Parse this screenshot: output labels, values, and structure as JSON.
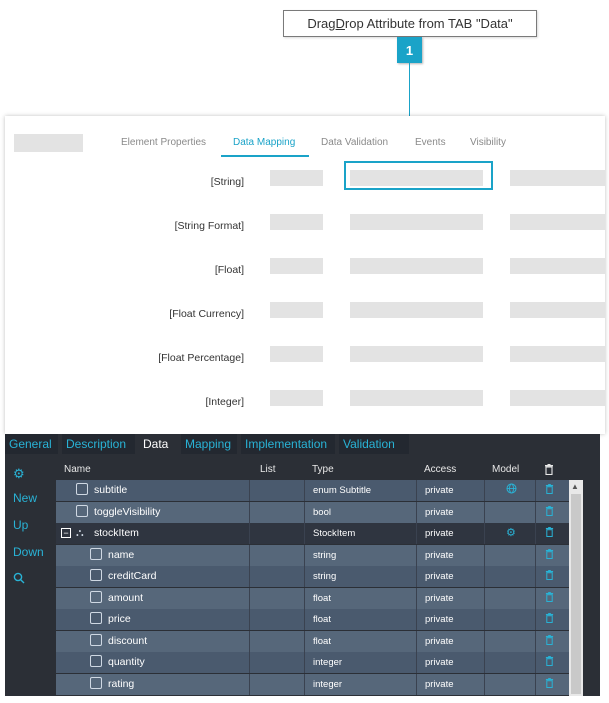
{
  "callout": {
    "text_pre": "Drag",
    "text_u": "D",
    "text_post": "rop Attribute from TAB \"Data\"",
    "badge": "1"
  },
  "properties_panel": {
    "tabs": [
      {
        "label": "Element Properties",
        "active": false
      },
      {
        "label": "Data Mapping",
        "active": true
      },
      {
        "label": "Data Validation",
        "active": false
      },
      {
        "label": "Events",
        "active": false
      },
      {
        "label": "Visibility",
        "active": false
      }
    ],
    "fields": [
      {
        "label": "[String]"
      },
      {
        "label": "[String Format]"
      },
      {
        "label": "[Float]"
      },
      {
        "label": "[Float Currency]"
      },
      {
        "label": "[Float Percentage]"
      },
      {
        "label": "[Integer]"
      }
    ]
  },
  "editor_panel": {
    "tabs": [
      {
        "label": "General",
        "active": false
      },
      {
        "label": "Description",
        "active": false
      },
      {
        "label": "Data",
        "active": true
      },
      {
        "label": "Mapping",
        "active": false
      },
      {
        "label": "Implementation",
        "active": false
      },
      {
        "label": "Validation",
        "active": false
      }
    ],
    "sidebar": {
      "icon_top": "gears-icon",
      "items": [
        "New",
        "Up",
        "Down"
      ],
      "icon_bottom": "search-icon"
    },
    "columns": [
      "Name",
      "List",
      "Type",
      "Access",
      "Model",
      "delete-icon"
    ],
    "rows": [
      {
        "name": "subtitle",
        "list": "",
        "type": "enum Subtitle",
        "access": "private",
        "model": "globe-icon",
        "indent": 1,
        "kind": "cube"
      },
      {
        "name": "toggleVisibility",
        "list": "",
        "type": "bool",
        "access": "private",
        "model": "",
        "indent": 1,
        "kind": "cube"
      },
      {
        "name": "stockItem",
        "list": "",
        "type": "StockItem",
        "access": "private",
        "model": "gears-icon",
        "indent": 1,
        "kind": "group",
        "expander": "−"
      },
      {
        "name": "name",
        "list": "",
        "type": "string",
        "access": "private",
        "model": "",
        "indent": 2,
        "kind": "cube"
      },
      {
        "name": "creditCard",
        "list": "",
        "type": "string",
        "access": "private",
        "model": "",
        "indent": 2,
        "kind": "cube"
      },
      {
        "name": "amount",
        "list": "",
        "type": "float",
        "access": "private",
        "model": "",
        "indent": 2,
        "kind": "cube"
      },
      {
        "name": "price",
        "list": "",
        "type": "float",
        "access": "private",
        "model": "",
        "indent": 2,
        "kind": "cube"
      },
      {
        "name": "discount",
        "list": "",
        "type": "float",
        "access": "private",
        "model": "",
        "indent": 2,
        "kind": "cube"
      },
      {
        "name": "quantity",
        "list": "",
        "type": "integer",
        "access": "private",
        "model": "",
        "indent": 2,
        "kind": "cube"
      },
      {
        "name": "rating",
        "list": "",
        "type": "integer",
        "access": "private",
        "model": "",
        "indent": 2,
        "kind": "cube"
      }
    ]
  },
  "colors": {
    "accent": "#1aa3c8",
    "panel_dark": "#2b2f36",
    "row_a": "#4a5a6e",
    "row_b": "#56677a"
  }
}
